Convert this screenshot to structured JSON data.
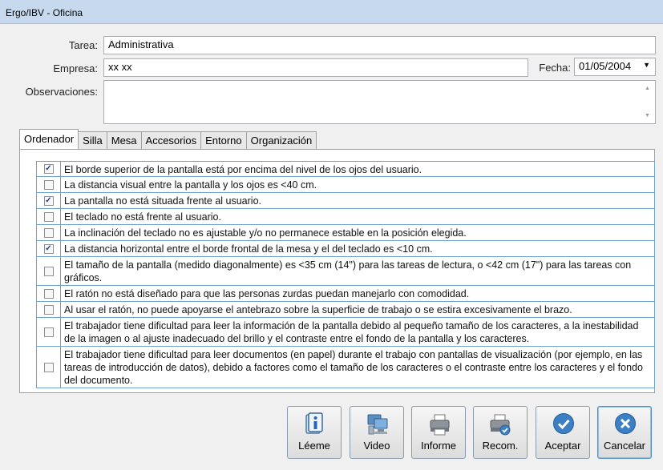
{
  "window": {
    "title": "Ergo/IBV - Oficina"
  },
  "form": {
    "tarea_label": "Tarea:",
    "tarea_value": "Administrativa",
    "empresa_label": "Empresa:",
    "empresa_value": "xx xx",
    "fecha_label": "Fecha:",
    "fecha_value": "01/05/2004",
    "observaciones_label": "Observaciones:",
    "observaciones_value": ""
  },
  "tabs": [
    {
      "label": "Ordenador",
      "active": true
    },
    {
      "label": "Silla"
    },
    {
      "label": "Mesa"
    },
    {
      "label": "Accesorios"
    },
    {
      "label": "Entorno"
    },
    {
      "label": "Organización"
    }
  ],
  "checklist": [
    {
      "checked": true,
      "text": "El borde superior de la pantalla está por encima del nivel de los ojos del usuario."
    },
    {
      "checked": false,
      "text": "La distancia visual entre la pantalla y los ojos es <40 cm."
    },
    {
      "checked": true,
      "text": "La pantalla no está situada frente al usuario."
    },
    {
      "checked": false,
      "text": "El teclado no está frente al usuario."
    },
    {
      "checked": false,
      "text": "La inclinación del teclado no es ajustable y/o no permanece estable en la posición elegida."
    },
    {
      "checked": true,
      "text": "La distancia horizontal entre el borde frontal de la mesa y el del teclado es <10 cm."
    },
    {
      "checked": false,
      "text": "El tamaño de la pantalla (medido diagonalmente) es <35 cm (14\") para las tareas de lectura, o <42 cm (17\") para las tareas con gráficos."
    },
    {
      "checked": false,
      "text": "El ratón no está diseñado para que las personas zurdas puedan manejarlo con comodidad."
    },
    {
      "checked": false,
      "text": "Al usar el ratón, no puede apoyarse el antebrazo sobre la superficie de trabajo o se estira excesivamente el brazo."
    },
    {
      "checked": false,
      "text": "El trabajador tiene dificultad para leer la información de la pantalla debido al pequeño tamaño de los caracteres, a la inestabilidad de la imagen o al ajuste inadecuado del brillo y el contraste entre el fondo de la pantalla y los caracteres."
    },
    {
      "checked": false,
      "text": "El trabajador tiene dificultad para leer documentos (en papel) durante el trabajo con pantallas de visualización (por ejemplo, en las tareas de introducción de datos), debido a factores como el tamaño de los caracteres o el contraste entre los caracteres y el fondo del documento."
    }
  ],
  "buttons": {
    "leeme": {
      "label": "Léeme",
      "icon": "document-info-icon"
    },
    "video": {
      "label": "Video",
      "icon": "video-computer-icon"
    },
    "informe": {
      "label": "Informe",
      "icon": "printer-icon"
    },
    "recom": {
      "label": "Recom.",
      "icon": "printer-check-icon"
    },
    "aceptar": {
      "label": "Aceptar",
      "icon": "checkmark-circle-icon"
    },
    "cancelar": {
      "label": "Cancelar",
      "icon": "close-circle-icon"
    }
  },
  "colors": {
    "accent": "#3c7fc4",
    "grid": "#6ea3cf",
    "titlebar": "#c6d9ee"
  }
}
